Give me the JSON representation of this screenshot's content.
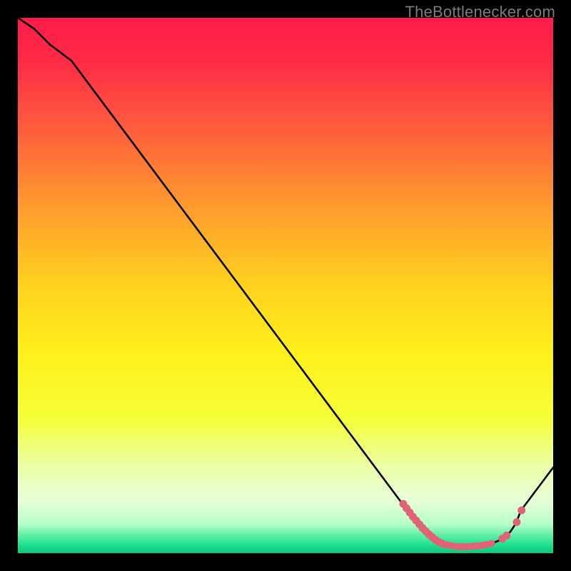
{
  "watermark": "TheBottlenecker.com",
  "colors": {
    "frame": "#000000",
    "line": "#000000",
    "marker_fill": "#e06377",
    "marker_stroke": "#e06377",
    "watermark": "#7b7b7b"
  },
  "gradient_stops": [
    {
      "offset": 0.0,
      "color": "#ff1b4b"
    },
    {
      "offset": 0.08,
      "color": "#ff2a46"
    },
    {
      "offset": 0.2,
      "color": "#ff5a3e"
    },
    {
      "offset": 0.35,
      "color": "#ff9a2e"
    },
    {
      "offset": 0.5,
      "color": "#ffd21e"
    },
    {
      "offset": 0.63,
      "color": "#fff11a"
    },
    {
      "offset": 0.75,
      "color": "#f5ff3a"
    },
    {
      "offset": 0.84,
      "color": "#ecffa8"
    },
    {
      "offset": 0.9,
      "color": "#e8ffd8"
    },
    {
      "offset": 0.945,
      "color": "#b8ffc8"
    },
    {
      "offset": 0.965,
      "color": "#66f0a8"
    },
    {
      "offset": 0.985,
      "color": "#1ee090"
    },
    {
      "offset": 1.0,
      "color": "#0cc97a"
    }
  ],
  "chart_data": {
    "type": "line",
    "title": "",
    "xlabel": "",
    "ylabel": "",
    "xlim": [
      0,
      100
    ],
    "ylim": [
      0,
      100
    ],
    "series": [
      {
        "name": "curve",
        "x": [
          0,
          3,
          6,
          10,
          72,
          74,
          75,
          76,
          77,
          78,
          79,
          80,
          81,
          82,
          83,
          84,
          85,
          86,
          87,
          88,
          89,
          90,
          91,
          92,
          93,
          94,
          100
        ],
        "y": [
          100,
          98,
          95,
          92,
          9,
          6.5,
          5,
          4,
          3,
          2.3,
          1.8,
          1.5,
          1.3,
          1.2,
          1.2,
          1.2,
          1.3,
          1.4,
          1.5,
          1.7,
          2.0,
          2.4,
          3.0,
          4.0,
          5.5,
          8.0,
          16
        ]
      }
    ],
    "markers": [
      {
        "x": 72.0,
        "y": 9.2,
        "r": 5
      },
      {
        "x": 72.6,
        "y": 8.4,
        "r": 5
      },
      {
        "x": 73.2,
        "y": 7.6,
        "r": 5
      },
      {
        "x": 73.8,
        "y": 6.8,
        "r": 5
      },
      {
        "x": 74.4,
        "y": 6.1,
        "r": 5
      },
      {
        "x": 75.0,
        "y": 5.4,
        "r": 5
      },
      {
        "x": 75.6,
        "y": 4.7,
        "r": 5
      },
      {
        "x": 76.2,
        "y": 4.1,
        "r": 5
      },
      {
        "x": 76.8,
        "y": 3.5,
        "r": 5
      },
      {
        "x": 77.4,
        "y": 3.0,
        "r": 5
      },
      {
        "x": 78.0,
        "y": 2.5,
        "r": 5
      },
      {
        "x": 78.6,
        "y": 2.1,
        "r": 5
      },
      {
        "x": 79.2,
        "y": 1.8,
        "r": 5
      },
      {
        "x": 79.8,
        "y": 1.6,
        "r": 4.5
      },
      {
        "x": 80.4,
        "y": 1.5,
        "r": 4.5
      },
      {
        "x": 81.0,
        "y": 1.4,
        "r": 4.5
      },
      {
        "x": 81.6,
        "y": 1.3,
        "r": 4.5
      },
      {
        "x": 82.2,
        "y": 1.25,
        "r": 4.5
      },
      {
        "x": 82.8,
        "y": 1.2,
        "r": 4.5
      },
      {
        "x": 83.4,
        "y": 1.2,
        "r": 4.5
      },
      {
        "x": 84.0,
        "y": 1.2,
        "r": 4.5
      },
      {
        "x": 84.6,
        "y": 1.25,
        "r": 4.5
      },
      {
        "x": 85.2,
        "y": 1.3,
        "r": 4.5
      },
      {
        "x": 85.8,
        "y": 1.35,
        "r": 4.5
      },
      {
        "x": 86.4,
        "y": 1.4,
        "r": 4.5
      },
      {
        "x": 87.0,
        "y": 1.5,
        "r": 4.5
      },
      {
        "x": 87.6,
        "y": 1.6,
        "r": 4.5
      },
      {
        "x": 88.5,
        "y": 1.8,
        "r": 4.5
      },
      {
        "x": 90.5,
        "y": 2.7,
        "r": 5
      },
      {
        "x": 91.3,
        "y": 3.3,
        "r": 5
      },
      {
        "x": 93.2,
        "y": 5.8,
        "r": 5
      },
      {
        "x": 94.1,
        "y": 8.0,
        "r": 5
      }
    ]
  }
}
